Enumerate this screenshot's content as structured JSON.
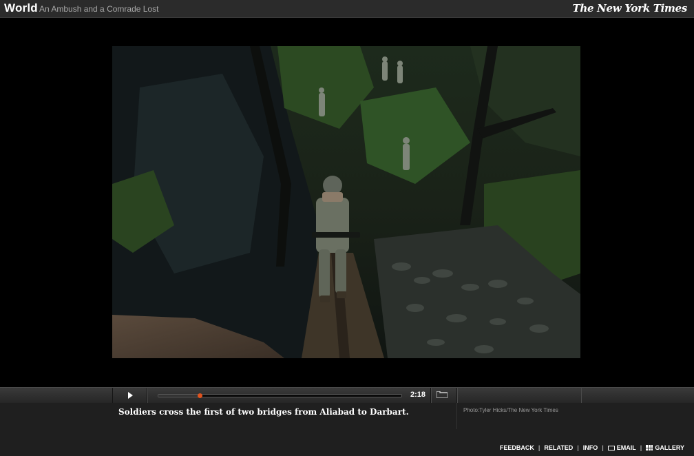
{
  "header": {
    "section": "World",
    "headline": "An Ambush and a Comrade Lost",
    "brand": "The New York Times"
  },
  "player": {
    "play_icon": "play-icon",
    "duration": "2:18",
    "progress": 0.17,
    "fullscreen_icon": "fullscreen-icon",
    "accent_color": "#e0531e"
  },
  "caption": {
    "text": "Soldiers cross the first of two bridges from Aliabad to Darbart.",
    "credit": "Photo:Tyler Hicks/The New York Times"
  },
  "footer": {
    "feedback": "FEEDBACK",
    "related": "RELATED",
    "info": "INFO",
    "email": "EMAIL",
    "gallery": "GALLERY"
  }
}
